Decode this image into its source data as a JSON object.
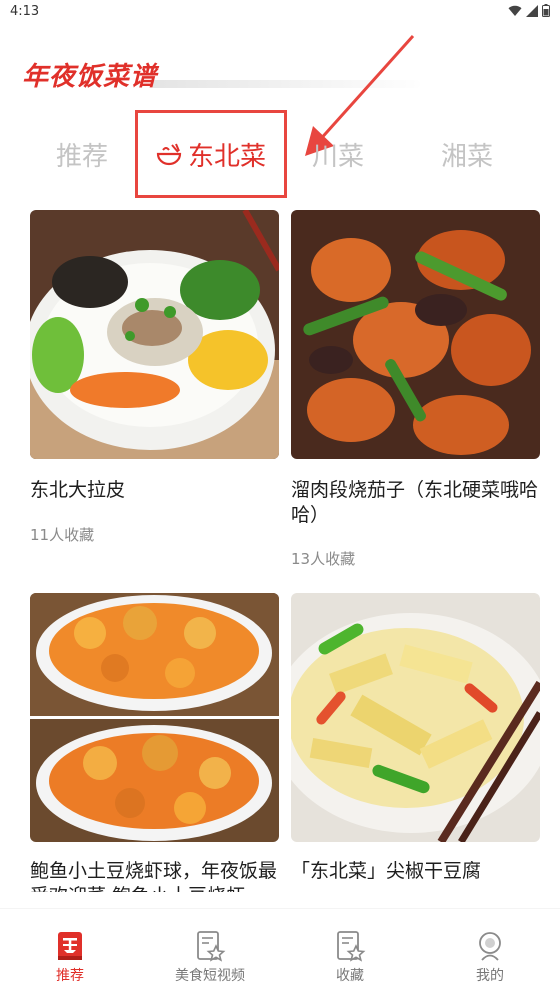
{
  "status": {
    "time": "4:13"
  },
  "app": {
    "title": "年夜饭菜谱"
  },
  "tabs": [
    {
      "label": "推荐"
    },
    {
      "label": "东北菜"
    },
    {
      "label": "川菜"
    },
    {
      "label": "湘菜"
    }
  ],
  "cards": [
    {
      "title": "东北大拉皮",
      "favorites": "11人收藏"
    },
    {
      "title": "溜肉段烧茄子（东北硬菜哦哈哈）",
      "favorites": "13人收藏"
    },
    {
      "title": "鲍鱼小土豆烧虾球，年夜饭最受欢迎菜 鲍鱼小土豆烧虾",
      "favorites": ""
    },
    {
      "title": "「东北菜」尖椒干豆腐",
      "favorites": ""
    }
  ],
  "bottom_nav": [
    {
      "label": "推荐",
      "icon": "recipe-book-icon"
    },
    {
      "label": "美食短视频",
      "icon": "video-star-icon"
    },
    {
      "label": "收藏",
      "icon": "favorites-star-icon"
    },
    {
      "label": "我的",
      "icon": "profile-icon"
    }
  ],
  "colors": {
    "accent": "#e0302a",
    "annotation": "#e8463f",
    "inactive_tab": "#c4c4c4"
  }
}
